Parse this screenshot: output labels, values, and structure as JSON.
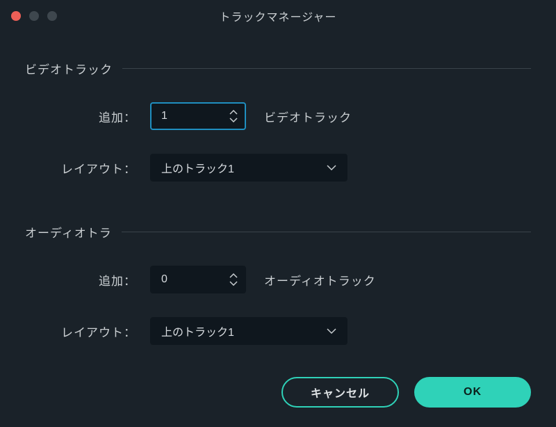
{
  "window": {
    "title": "トラックマネージャー"
  },
  "video": {
    "section_label": "ビデオトラック",
    "add_label": "追加：",
    "add_value": "1",
    "add_suffix": "ビデオトラック",
    "layout_label": "レイアウト：",
    "layout_value": "上のトラック1"
  },
  "audio": {
    "section_label": "オーディオトラ",
    "add_label": "追加：",
    "add_value": "0",
    "add_suffix": "オーディオトラック",
    "layout_label": "レイアウト：",
    "layout_value": "上のトラック1"
  },
  "buttons": {
    "cancel": "キャンセル",
    "ok": "OK"
  },
  "colors": {
    "accent": "#2fd2b8",
    "focus": "#1f8fc0",
    "bg": "#1a2229",
    "field_bg": "#0f171e"
  }
}
